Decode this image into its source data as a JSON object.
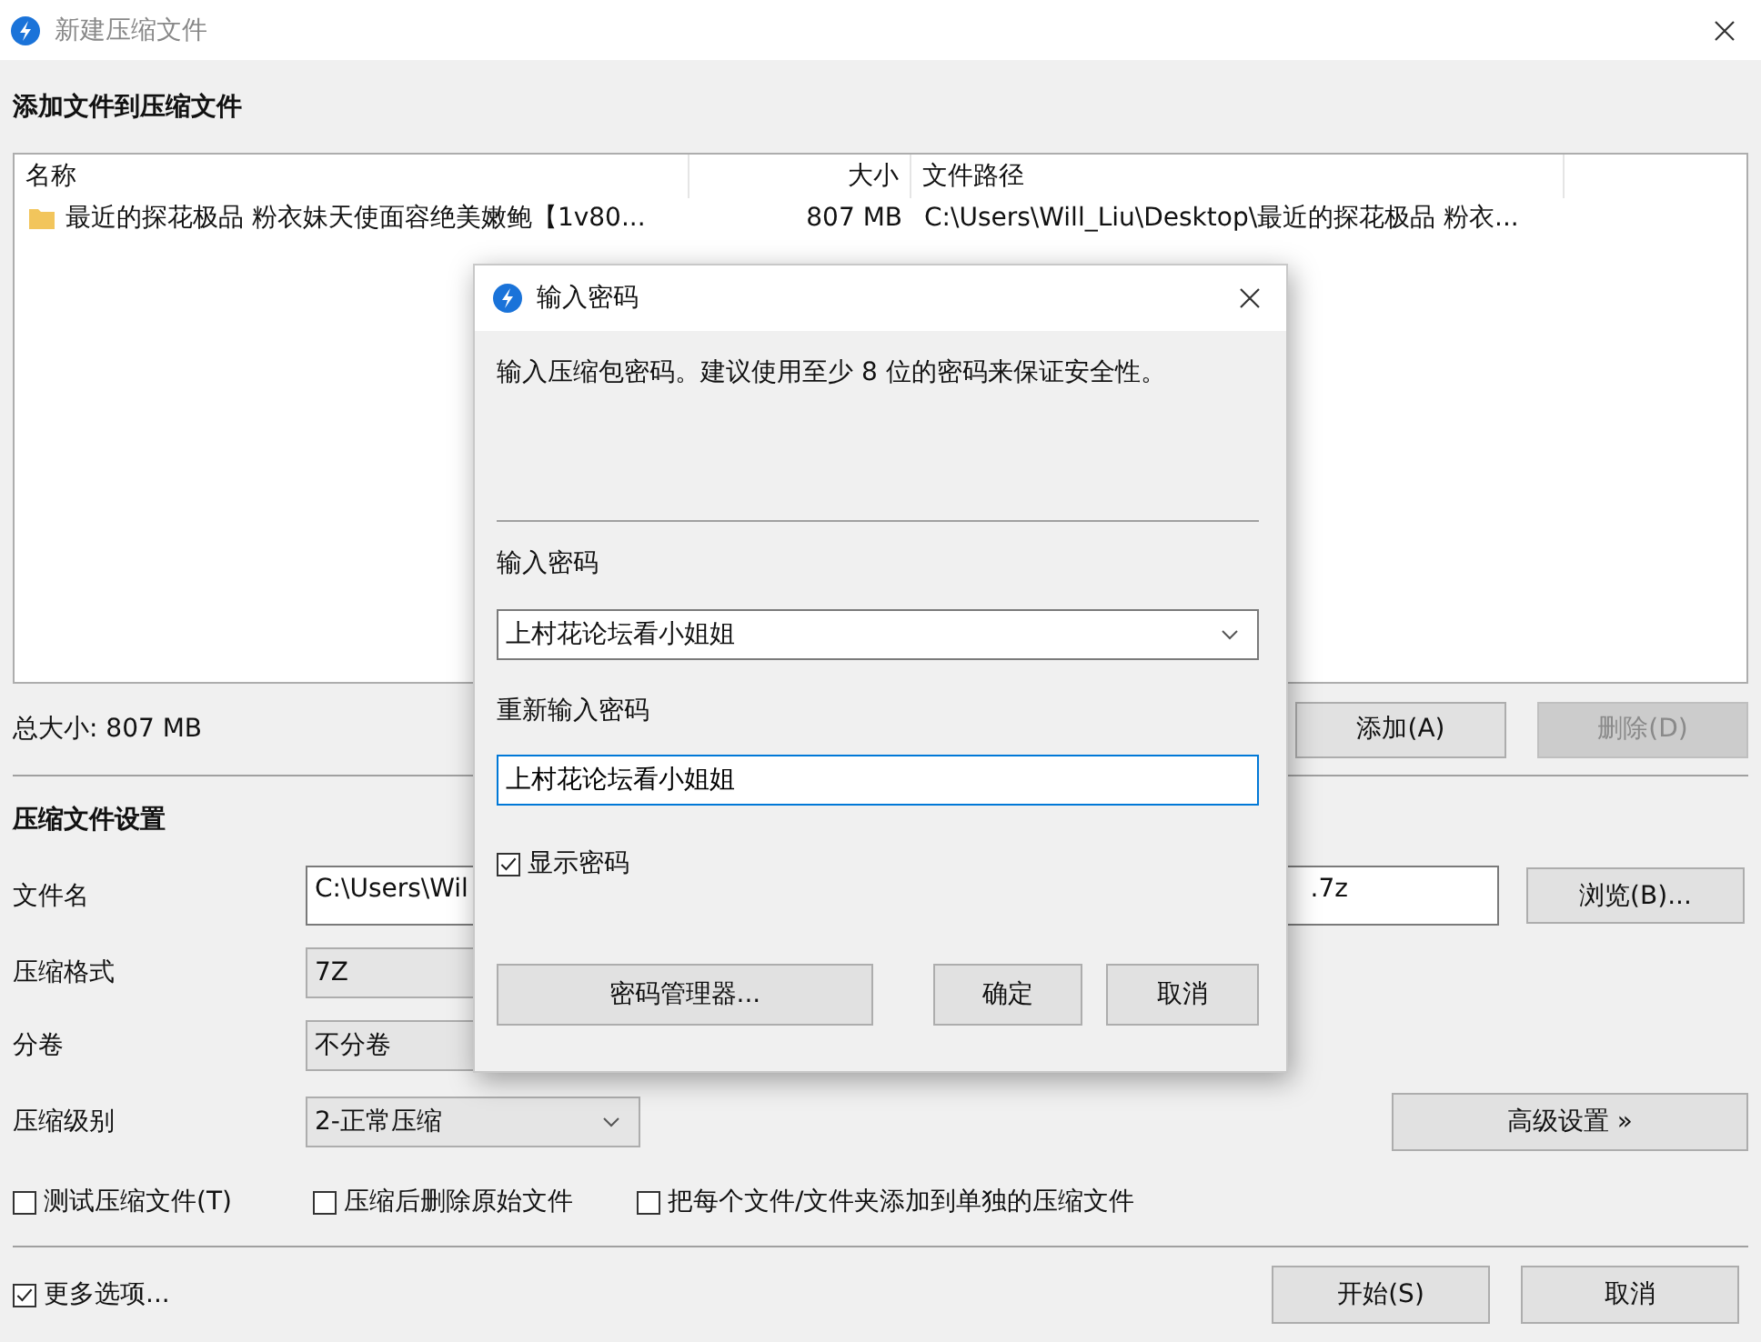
{
  "window": {
    "title": "新建压缩文件"
  },
  "files": {
    "heading": "添加文件到压缩文件",
    "columns": [
      "名称",
      "大小",
      "文件路径"
    ],
    "rows": [
      {
        "kind": "folder",
        "name": "最近的探花极品 粉衣妹天使面容绝美嫩鲍【1v80...",
        "size": "807 MB",
        "path": "C:\\Users\\Will_Liu\\Desktop\\最近的探花极品 粉衣..."
      }
    ],
    "total_size": "总大小: 807 MB",
    "buttons": [
      {
        "label": "添加(A)",
        "disabled": false
      },
      {
        "label": "删除(D)",
        "disabled": true
      }
    ]
  },
  "settings": {
    "heading": "压缩文件设置",
    "file_name": {
      "label": "文件名",
      "value_start": "C:\\Users\\Wil",
      "value_end": ".7z",
      "button": "浏览(B)..."
    },
    "format": {
      "label": "压缩格式",
      "value": "7Z"
    },
    "split": {
      "label": "分卷",
      "value": "不分卷"
    },
    "level": {
      "label": "压缩级别",
      "value": "2-正常压缩",
      "button": "高级设置 »"
    },
    "options": [
      {
        "label": "测试压缩文件(T)",
        "checked": false
      },
      {
        "label": "压缩后删除原始文件",
        "checked": false
      },
      {
        "label": "把每个文件/文件夹添加到单独的压缩文件",
        "checked": false
      }
    ]
  },
  "footer": {
    "more_options": {
      "label": "更多选项...",
      "checked": true
    },
    "buttons": [
      "开始(S)",
      "取消"
    ]
  },
  "dialog": {
    "title": "输入密码",
    "message": "输入压缩包密码。建议使用至少 8 位的密码来保证安全性。",
    "password": {
      "label": "输入密码",
      "value": "上村花论坛看小姐姐"
    },
    "confirm": {
      "label": "重新输入密码",
      "value": "上村花论坛看小姐姐"
    },
    "show_password": {
      "label": "显示密码",
      "checked": true
    },
    "buttons": [
      "密码管理器...",
      "确定",
      "取消"
    ]
  }
}
